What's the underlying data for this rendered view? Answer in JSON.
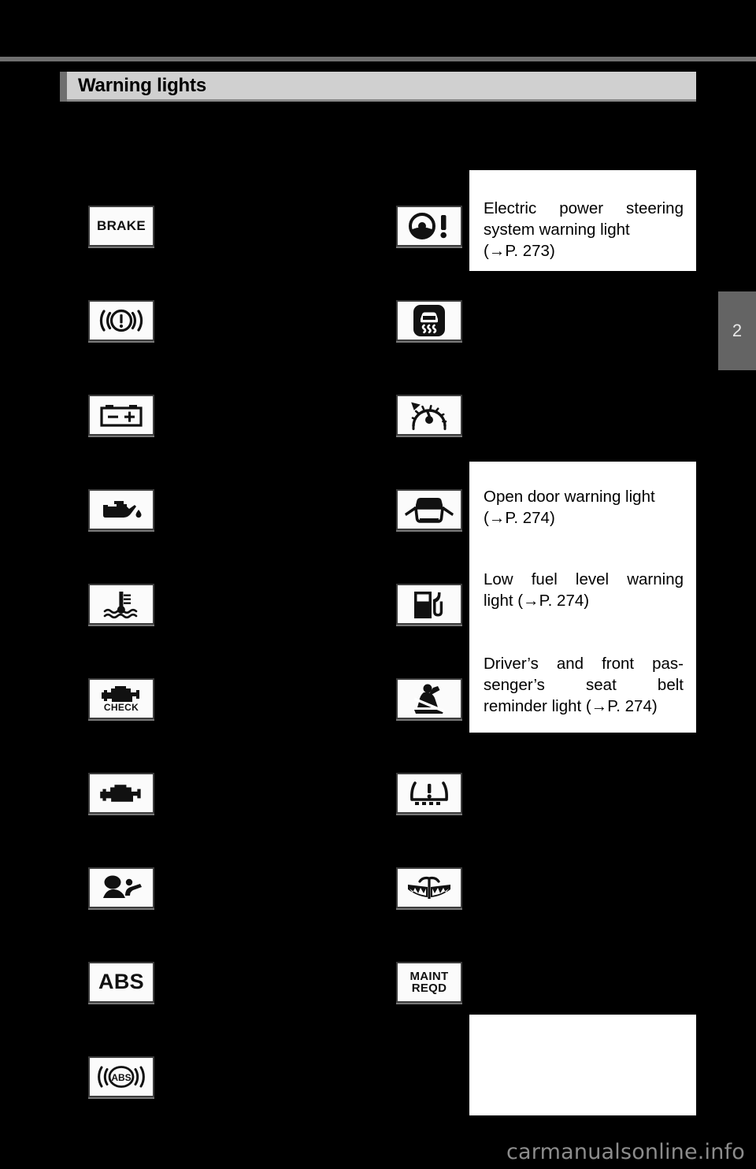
{
  "page": {
    "background_color": "#000000",
    "chapter_tab": "2",
    "watermark": "carmanualsonline.info"
  },
  "header": {
    "title": "Warning lights",
    "accent_color": "#6f6f6f",
    "bar_color": "#d0d0d0"
  },
  "left_column": {
    "items": [
      {
        "icon": "brake-warning-light-icon",
        "label": "BRAKE"
      },
      {
        "icon": "brake-system-circle-warning-light-icon",
        "label": ""
      },
      {
        "icon": "charging-system-battery-warning-light-icon",
        "label": ""
      },
      {
        "icon": "low-engine-oil-pressure-warning-light-icon",
        "label": ""
      },
      {
        "icon": "engine-coolant-temperature-warning-light-icon",
        "label": ""
      },
      {
        "icon": "check-engine-warning-light-icon",
        "label": "CHECK"
      },
      {
        "icon": "malfunction-indicator-engine-icon",
        "label": ""
      },
      {
        "icon": "srs-airbag-warning-light-icon",
        "label": ""
      },
      {
        "icon": "abs-warning-light-icon",
        "label": "ABS"
      },
      {
        "icon": "brake-assist-abs-circle-warning-light-icon",
        "label": "ABS"
      }
    ]
  },
  "right_column": {
    "items": [
      {
        "icon": "electric-power-steering-warning-light-icon",
        "label": ""
      },
      {
        "icon": "slip-indicator-vsc-warning-light-icon",
        "label": ""
      },
      {
        "icon": "cruise-control-speedometer-warning-light-icon",
        "label": ""
      },
      {
        "icon": "open-door-warning-light-icon",
        "label": ""
      },
      {
        "icon": "low-fuel-level-warning-light-icon",
        "label": ""
      },
      {
        "icon": "seat-belt-reminder-light-icon",
        "label": ""
      },
      {
        "icon": "tire-pressure-warning-light-icon",
        "label": ""
      },
      {
        "icon": "washer-fluid-level-warning-light-icon",
        "label": ""
      },
      {
        "icon": "maintenance-required-light-icon",
        "label": "MAINT REQD",
        "label_line1": "MAINT",
        "label_line2": "REQD"
      }
    ]
  },
  "descriptions": {
    "box_top": {
      "lines": [
        "Electric power steering",
        "system warning light",
        "(→P. 273)"
      ],
      "text": "Electric power steering system warning light (→P. 273)",
      "page_ref": "P. 273"
    },
    "box_middle_items": [
      {
        "text": "Open door warning light (→P. 274)",
        "line1": "Open door warning light",
        "line2": "(→P. 274)",
        "page_ref": "P. 274"
      },
      {
        "text": "Low fuel level warning light (→P. 274)",
        "line1": "Low fuel level warning",
        "line2": "light (→P. 274)",
        "page_ref": "P. 274"
      },
      {
        "text": "Driver’s and front passenger’s seat belt reminder light (→P. 274)",
        "line1": "Driver’s and front pas-",
        "line2": "senger’s seat belt",
        "line3": "reminder light (→P. 274)",
        "page_ref": "P. 274"
      }
    ],
    "box_bottom": {
      "text": ""
    }
  }
}
